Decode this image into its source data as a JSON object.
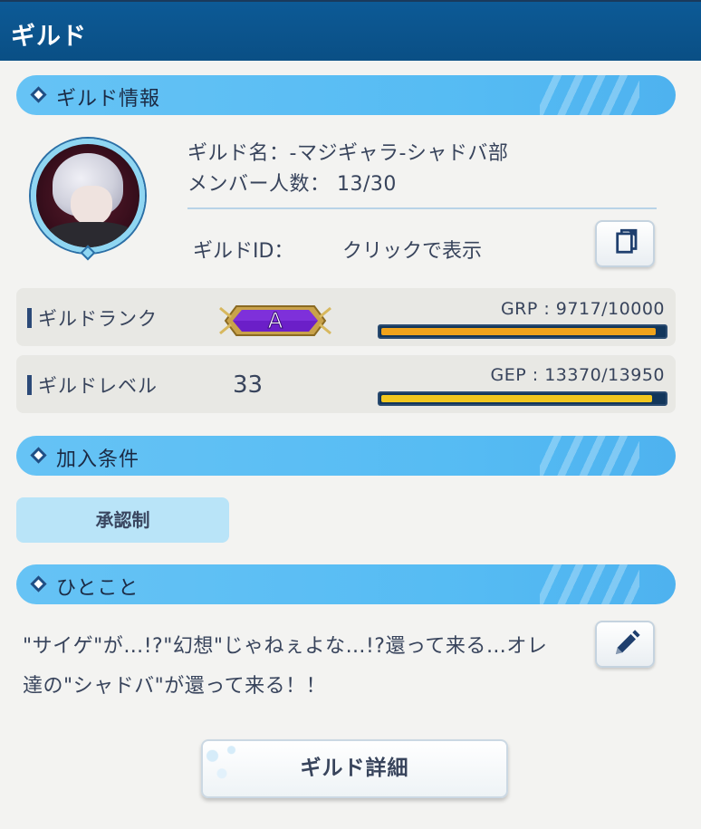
{
  "app": {
    "title": "ギルド"
  },
  "sections": {
    "info": "ギルド情報",
    "join": "加入条件",
    "comment": "ひとこと"
  },
  "guild": {
    "name_line": "ギルド名：-マジギャラ-シャドバ部",
    "members_line": "メンバー人数： 13/30",
    "id_label": "ギルドID：",
    "id_value": "クリックで表示",
    "copy_icon": "copy-icon"
  },
  "rank": {
    "label": "ギルドランク",
    "badge_letter": "A",
    "grp_text": "GRP : 9717/10000",
    "grp_current": 9717,
    "grp_max": 10000,
    "bar_color": "#f0a31b"
  },
  "level": {
    "label": "ギルドレベル",
    "value": "33",
    "gep_text": "GEP : 13370/13950",
    "gep_current": 13370,
    "gep_max": 13950,
    "bar_color": "#f2c71e"
  },
  "join_condition": "承認制",
  "comment": {
    "text": "\"サイゲ\"が…!?\"幻想\"じゃねぇよな…!?還って来る…オレ達の\"シャドバ\"が還って来る！！",
    "edit_icon": "pencil-icon"
  },
  "detail_button": "ギルド詳細",
  "colors": {
    "title_bar": "#0a4f85",
    "section_header": "#5bbdf4",
    "accent_dark": "#1e4f86"
  }
}
